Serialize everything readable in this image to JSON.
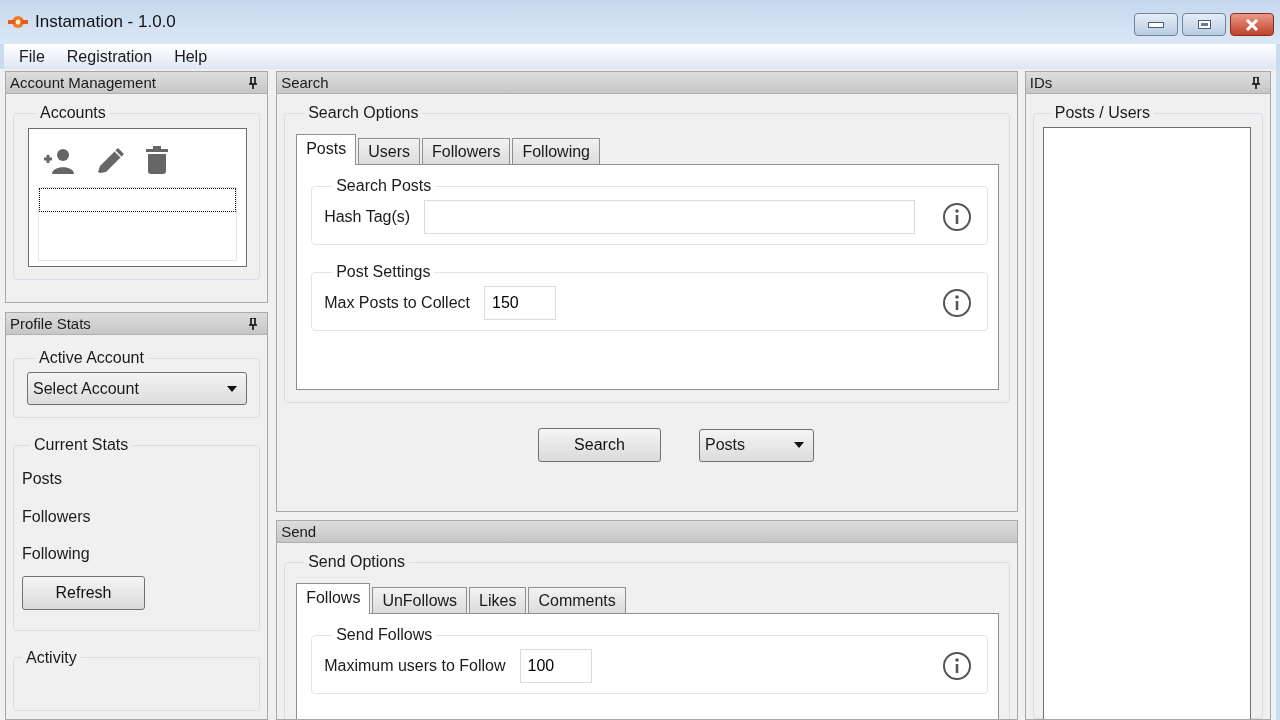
{
  "window": {
    "title": "Instamation - 1.0.0"
  },
  "menu": [
    {
      "label": "File"
    },
    {
      "label": "Registration"
    },
    {
      "label": "Help"
    }
  ],
  "account_management": {
    "title": "Account Management",
    "group": "Accounts"
  },
  "profile_stats": {
    "title": "Profile Stats",
    "active_account": {
      "title": "Active Account",
      "select": "Select Account"
    },
    "current_stats": {
      "title": "Current Stats",
      "items": [
        "Posts",
        "Followers",
        "Following"
      ],
      "button": "Refresh"
    },
    "activity": {
      "title": "Activity"
    }
  },
  "search": {
    "title": "Search",
    "group": "Search Options",
    "tabs": [
      {
        "label": "Posts",
        "selected": true
      },
      {
        "label": "Users",
        "selected": false
      },
      {
        "label": "Followers",
        "selected": false
      },
      {
        "label": "Following",
        "selected": false
      }
    ],
    "sections": [
      {
        "title": "Search Posts",
        "label": "Hash Tag(s)",
        "kind": "text"
      },
      {
        "title": "Post Settings",
        "label": "Max Posts to Collect",
        "kind": "number",
        "value": "150"
      }
    ],
    "button": "Search",
    "type_select": "Posts"
  },
  "send": {
    "title": "Send",
    "group": "Send Options",
    "tabs": [
      {
        "label": "Follows",
        "selected": true
      },
      {
        "label": "UnFollows",
        "selected": false
      },
      {
        "label": "Likes",
        "selected": false
      },
      {
        "label": "Comments",
        "selected": false
      }
    ],
    "sections": [
      {
        "title": "Send Follows",
        "label": "Maximum users to Follow",
        "kind": "number",
        "value": "100"
      }
    ]
  },
  "ids": {
    "title": "IDs",
    "group": "Posts / Users"
  }
}
